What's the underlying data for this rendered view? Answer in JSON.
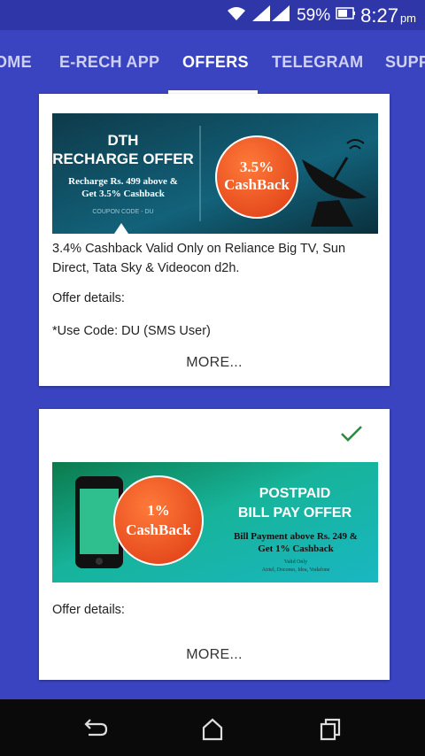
{
  "status_bar": {
    "battery": "59%",
    "time": "8:27",
    "ampm": "pm"
  },
  "tabs": [
    {
      "label": "OME",
      "active": false
    },
    {
      "label": "E-RECH APP",
      "active": false
    },
    {
      "label": "OFFERS",
      "active": true
    },
    {
      "label": "TELEGRAM",
      "active": false
    },
    {
      "label": "SUPP",
      "active": false
    }
  ],
  "offers": [
    {
      "banner": {
        "title_line1": "DTH",
        "title_line2": "RECHARGE OFFER",
        "subtitle_line1": "Recharge Rs. 499 above &",
        "subtitle_line2": "Get 3.5% Cashback",
        "code": "COUPON CODE - DU",
        "badge_line1": "3.5%",
        "badge_line2": "CashBack"
      },
      "description": "3.4% Cashback Valid Only on Reliance Big TV, Sun Direct, Tata Sky & Videocon d2h.",
      "details_label": "Offer details:",
      "code_note": "*Use Code: DU (SMS User)",
      "more_label": "MORE..."
    },
    {
      "banner": {
        "title_line1": "POSTPAID",
        "title_line2": "BILL PAY OFFER",
        "subtitle_line1": "Bill Payment above Rs. 249 &",
        "subtitle_line2": "Get 1% Cashback",
        "valid_line1": "Valid Only",
        "valid_line2": "Airtel, Docomo, Idea, Vodafone",
        "badge_line1": "1%",
        "badge_line2": "CashBack"
      },
      "details_label": "Offer details:",
      "more_label": "MORE..."
    }
  ],
  "icons": {
    "wifi": "wifi-icon",
    "signal": "signal-icon",
    "battery": "battery-icon",
    "check": "check-icon",
    "back": "back-icon",
    "home": "home-icon",
    "recents": "recents-icon"
  },
  "colors": {
    "primary": "#3a44c0",
    "status_bar": "#2f36a8",
    "check": "#2e8b3e",
    "badge": "#e8501e"
  }
}
